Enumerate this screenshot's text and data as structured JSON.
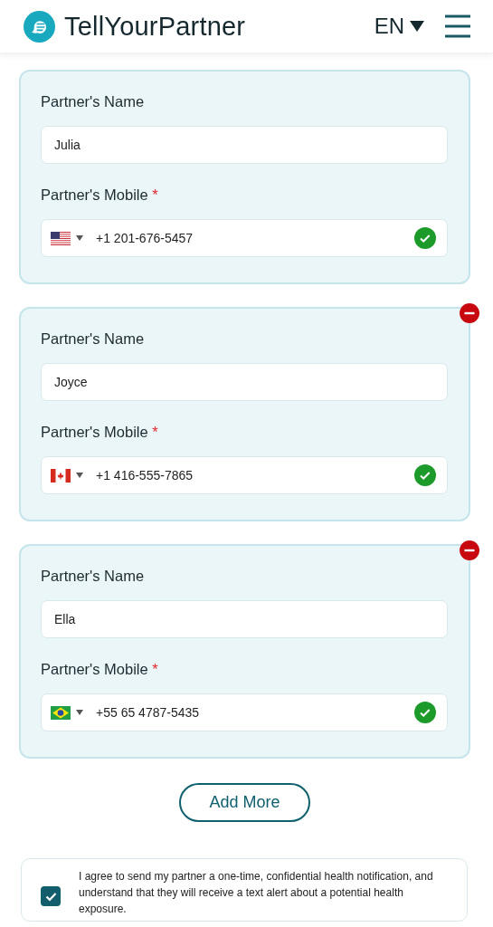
{
  "header": {
    "brand": "TellYourPartner",
    "language": "EN"
  },
  "partners": [
    {
      "name_label": "Partner's Name",
      "name": "Julia",
      "mobile_label": "Partner's Mobile",
      "required_mark": "*",
      "kind": "us",
      "mobile": "+1 201-676-5457",
      "valid": true,
      "removable": false
    },
    {
      "name_label": "Partner's Name",
      "name": "Joyce",
      "mobile_label": "Partner's Mobile",
      "required_mark": "*",
      "kind": "ca",
      "mobile": "+1 416-555-7865",
      "valid": true,
      "removable": true
    },
    {
      "name_label": "Partner's Name",
      "name": "Ella",
      "mobile_label": "Partner's Mobile",
      "required_mark": "*",
      "kind": "br",
      "mobile": "+55 65 4787-5435",
      "valid": true,
      "removable": true
    }
  ],
  "add_button": "Add More",
  "consent": {
    "checked": true,
    "text": "I agree to send my partner a one-time, confidential health notification, and understand that they will receive a text alert about a potential health exposure."
  }
}
